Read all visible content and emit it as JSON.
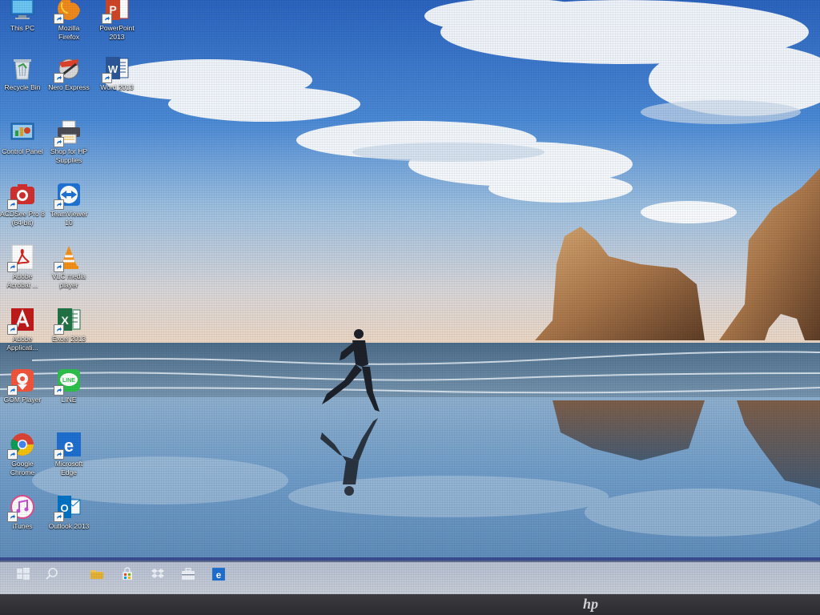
{
  "desktop": {
    "icons": [
      {
        "name": "this-pc",
        "label": "This PC",
        "icon": "pc-icon",
        "col": 0,
        "row": 0,
        "shortcut": false
      },
      {
        "name": "mozilla-firefox",
        "label": "Mozilla\nFirefox",
        "icon": "firefox-icon",
        "col": 1,
        "row": 0,
        "shortcut": true
      },
      {
        "name": "powerpoint-2013",
        "label": "PowerPoint\n2013",
        "icon": "powerpoint-icon",
        "col": 2,
        "row": 0,
        "shortcut": true
      },
      {
        "name": "recycle-bin",
        "label": "Recycle Bin",
        "icon": "recycle-bin-icon",
        "col": 0,
        "row": 1,
        "shortcut": false
      },
      {
        "name": "nero-express",
        "label": "Nero Express",
        "icon": "nero-icon",
        "col": 1,
        "row": 1,
        "shortcut": true
      },
      {
        "name": "word-2013",
        "label": "Word 2013",
        "icon": "word-icon",
        "col": 2,
        "row": 1,
        "shortcut": true
      },
      {
        "name": "control-panel",
        "label": "Control Panel",
        "icon": "control-panel-icon",
        "col": 0,
        "row": 2,
        "shortcut": false
      },
      {
        "name": "shop-for-hp-supplies",
        "label": "Shop for HP\nSupplies",
        "icon": "hp-printer-icon",
        "col": 1,
        "row": 2,
        "shortcut": true
      },
      {
        "name": "acdsee-pro-8",
        "label": "ACDSee Pro 8\n(64-bit)",
        "icon": "acdsee-icon",
        "col": 0,
        "row": 3,
        "shortcut": true
      },
      {
        "name": "teamviewer-10",
        "label": "TeamViewer\n10",
        "icon": "teamviewer-icon",
        "col": 1,
        "row": 3,
        "shortcut": true
      },
      {
        "name": "adobe-acrobat",
        "label": "Adobe\nAcrobat ...",
        "icon": "acrobat-icon",
        "col": 0,
        "row": 4,
        "shortcut": true
      },
      {
        "name": "vlc-media-player",
        "label": "VLC media\nplayer",
        "icon": "vlc-icon",
        "col": 1,
        "row": 4,
        "shortcut": true
      },
      {
        "name": "adobe-application",
        "label": "Adobe\nApplicati...",
        "icon": "adobe-app-icon",
        "col": 0,
        "row": 5,
        "shortcut": true
      },
      {
        "name": "excel-2013",
        "label": "Excel 2013",
        "icon": "excel-icon",
        "col": 1,
        "row": 5,
        "shortcut": true
      },
      {
        "name": "gom-player",
        "label": "GOM Player",
        "icon": "gom-player-icon",
        "col": 0,
        "row": 6,
        "shortcut": true
      },
      {
        "name": "line",
        "label": "LINE",
        "icon": "line-icon",
        "col": 1,
        "row": 6,
        "shortcut": true
      },
      {
        "name": "google-chrome",
        "label": "Google\nChrome",
        "icon": "chrome-icon",
        "col": 0,
        "row": 7,
        "shortcut": true
      },
      {
        "name": "microsoft-edge",
        "label": "Microsoft\nEdge",
        "icon": "edge-icon",
        "col": 1,
        "row": 7,
        "shortcut": true
      },
      {
        "name": "itunes",
        "label": "iTunes",
        "icon": "itunes-icon",
        "col": 0,
        "row": 8,
        "shortcut": true
      },
      {
        "name": "outlook-2013",
        "label": "Outlook 2013",
        "icon": "outlook-icon",
        "col": 1,
        "row": 8,
        "shortcut": true
      }
    ]
  },
  "taskbar": {
    "items": [
      {
        "name": "start",
        "icon": "windows-start-icon"
      },
      {
        "name": "search",
        "icon": "search-icon"
      },
      {
        "name": "file-explorer",
        "icon": "folder-icon"
      },
      {
        "name": "store",
        "icon": "store-icon"
      },
      {
        "name": "dropbox",
        "icon": "dropbox-icon"
      },
      {
        "name": "mail-briefcase",
        "icon": "briefcase-icon"
      },
      {
        "name": "edge",
        "icon": "edge-icon"
      }
    ]
  },
  "monitor": {
    "brand": "hp"
  },
  "colors": {
    "sky_top": "#2f6fc6",
    "sky_bottom": "#e9d9c7",
    "sea": "#4a6d8e",
    "sand": "#6d8fae",
    "taskbar": "#c8ced8",
    "bezel": "#2c2c30"
  }
}
